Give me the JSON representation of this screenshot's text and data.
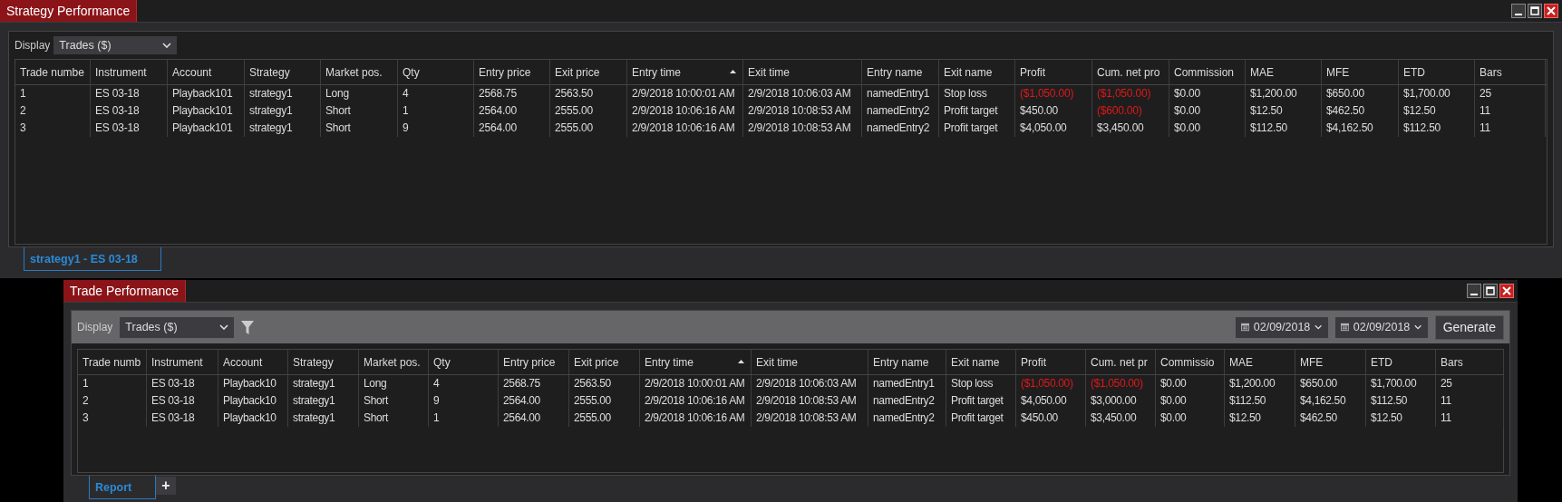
{
  "windows": [
    {
      "kind": "strategy",
      "title": "Strategy Performance",
      "display": {
        "label": "Display",
        "value": "Trades ($)"
      },
      "table": {
        "columns": [
          {
            "label": "Trade numbe",
            "sorted": false
          },
          {
            "label": "Instrument",
            "sorted": false
          },
          {
            "label": "Account",
            "sorted": false
          },
          {
            "label": "Strategy",
            "sorted": false
          },
          {
            "label": "Market pos.",
            "sorted": false
          },
          {
            "label": "Qty",
            "sorted": false
          },
          {
            "label": "Entry price",
            "sorted": false
          },
          {
            "label": "Exit price",
            "sorted": false
          },
          {
            "label": "Entry time",
            "sorted": true
          },
          {
            "label": "Exit time",
            "sorted": false
          },
          {
            "label": "Entry name",
            "sorted": false
          },
          {
            "label": "Exit name",
            "sorted": false
          },
          {
            "label": "Profit",
            "sorted": false
          },
          {
            "label": "Cum. net pro",
            "sorted": false
          },
          {
            "label": "Commission",
            "sorted": false
          },
          {
            "label": "MAE",
            "sorted": false
          },
          {
            "label": "MFE",
            "sorted": false
          },
          {
            "label": "ETD",
            "sorted": false
          },
          {
            "label": "Bars",
            "sorted": false
          }
        ],
        "rows": [
          [
            "1",
            "ES 03-18",
            "Playback101",
            "strategy1",
            "Long",
            "4",
            "2568.75",
            "2563.50",
            "2/9/2018 10:00:01 AM",
            "2/9/2018 10:06:03 AM",
            "namedEntry1",
            "Stop loss",
            {
              "text": "($1,050.00)",
              "negative": true
            },
            {
              "text": "($1,050.00)",
              "negative": true
            },
            "$0.00",
            "$1,200.00",
            "$650.00",
            "$1,700.00",
            "25"
          ],
          [
            "2",
            "ES 03-18",
            "Playback101",
            "strategy1",
            "Short",
            "1",
            "2564.00",
            "2555.00",
            "2/9/2018 10:06:16 AM",
            "2/9/2018 10:08:53 AM",
            "namedEntry2",
            "Profit target",
            {
              "text": "$450.00",
              "negative": false
            },
            {
              "text": "($600.00)",
              "negative": true
            },
            "$0.00",
            "$12.50",
            "$462.50",
            "$12.50",
            "11"
          ],
          [
            "3",
            "ES 03-18",
            "Playback101",
            "strategy1",
            "Short",
            "9",
            "2564.00",
            "2555.00",
            "2/9/2018 10:06:16 AM",
            "2/9/2018 10:08:53 AM",
            "namedEntry2",
            "Profit target",
            {
              "text": "$4,050.00",
              "negative": false
            },
            {
              "text": "$3,450.00",
              "negative": false
            },
            "$0.00",
            "$112.50",
            "$4,162.50",
            "$112.50",
            "11"
          ]
        ]
      },
      "tabs": [
        {
          "label": "strategy1 - ES 03-18",
          "selected": true
        }
      ]
    },
    {
      "kind": "trade",
      "title": "Trade Performance",
      "display": {
        "label": "Display",
        "value": "Trades ($)"
      },
      "dates": [
        "02/09/2018",
        "02/09/2018"
      ],
      "generate": "Generate",
      "table": {
        "columns": [
          {
            "label": "Trade numb",
            "sorted": false
          },
          {
            "label": "Instrument",
            "sorted": false
          },
          {
            "label": "Account",
            "sorted": false
          },
          {
            "label": "Strategy",
            "sorted": false
          },
          {
            "label": "Market pos.",
            "sorted": false
          },
          {
            "label": "Qty",
            "sorted": false
          },
          {
            "label": "Entry price",
            "sorted": false
          },
          {
            "label": "Exit price",
            "sorted": false
          },
          {
            "label": "Entry time",
            "sorted": true
          },
          {
            "label": "Exit time",
            "sorted": false
          },
          {
            "label": "Entry name",
            "sorted": false
          },
          {
            "label": "Exit name",
            "sorted": false
          },
          {
            "label": "Profit",
            "sorted": false
          },
          {
            "label": "Cum. net pr",
            "sorted": false
          },
          {
            "label": "Commissio",
            "sorted": false
          },
          {
            "label": "MAE",
            "sorted": false
          },
          {
            "label": "MFE",
            "sorted": false
          },
          {
            "label": "ETD",
            "sorted": false
          },
          {
            "label": "Bars",
            "sorted": false
          }
        ],
        "rows": [
          [
            "1",
            "ES 03-18",
            "Playback10",
            "strategy1",
            "Long",
            "4",
            "2568.75",
            "2563.50",
            "2/9/2018 10:00:01 AM",
            "2/9/2018 10:06:03 AM",
            "namedEntry1",
            "Stop loss",
            {
              "text": "($1,050.00)",
              "negative": true
            },
            {
              "text": "($1,050.00)",
              "negative": true
            },
            "$0.00",
            "$1,200.00",
            "$650.00",
            "$1,700.00",
            "25"
          ],
          [
            "2",
            "ES 03-18",
            "Playback10",
            "strategy1",
            "Short",
            "9",
            "2564.00",
            "2555.00",
            "2/9/2018 10:06:16 AM",
            "2/9/2018 10:08:53 AM",
            "namedEntry2",
            "Profit target",
            {
              "text": "$4,050.00",
              "negative": false
            },
            {
              "text": "$3,000.00",
              "negative": false
            },
            "$0.00",
            "$112.50",
            "$4,162.50",
            "$112.50",
            "11"
          ],
          [
            "3",
            "ES 03-18",
            "Playback10",
            "strategy1",
            "Short",
            "1",
            "2564.00",
            "2555.00",
            "2/9/2018 10:06:16 AM",
            "2/9/2018 10:08:53 AM",
            "namedEntry2",
            "Profit target",
            {
              "text": "$450.00",
              "negative": false
            },
            {
              "text": "$3,450.00",
              "negative": false
            },
            "$0.00",
            "$12.50",
            "$462.50",
            "$12.50",
            "11"
          ]
        ]
      },
      "tabs": [
        {
          "label": "Report",
          "selected": true
        }
      ],
      "add_tab": "+"
    }
  ]
}
